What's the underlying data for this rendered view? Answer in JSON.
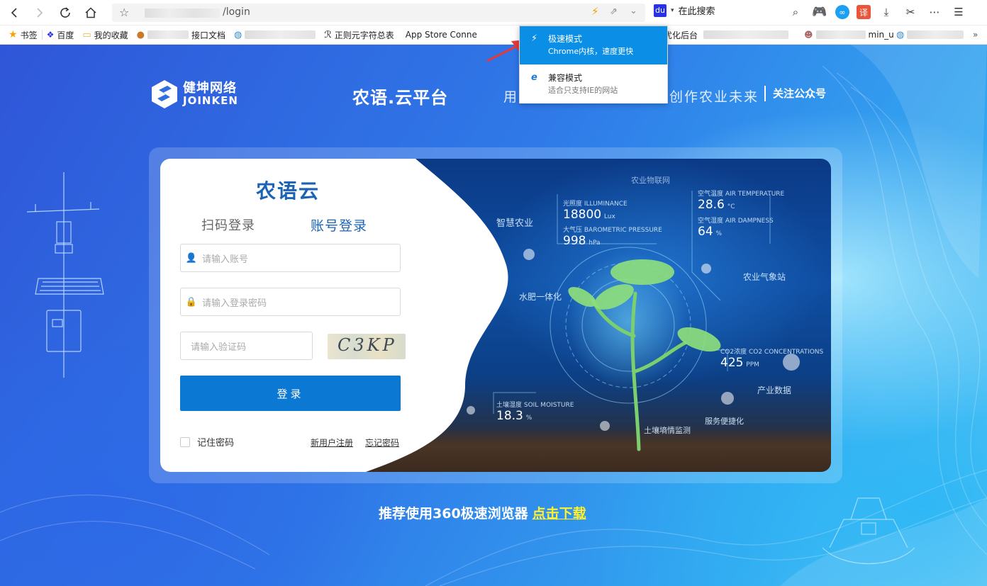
{
  "browser": {
    "address": {
      "url_visible": "/login"
    },
    "search": {
      "label": "在此搜索"
    },
    "bookmarks": [
      {
        "label": "书签"
      },
      {
        "label": "百度"
      },
      {
        "label": "我的收藏"
      },
      {
        "label": "接口文档"
      },
      {
        "label": "正则元字符总表"
      },
      {
        "label": "App Store Conne"
      },
      {
        "label": "优化后台"
      },
      {
        "label": "min_u"
      }
    ],
    "speed_menu": {
      "fast": {
        "title": "极速模式",
        "desc": "Chrome内核，速度更快"
      },
      "compat": {
        "title": "兼容模式",
        "desc": "适合只支持IE的网站"
      }
    }
  },
  "header": {
    "logo_cn": "健坤网络",
    "logo_en": "JOINKEN",
    "platform": "农语.云平台",
    "slogan_a": "用",
    "slogan_b": "创作农业未来",
    "follow": "关注公众号"
  },
  "login": {
    "brand": "农语云",
    "tab_qr": "扫码登录",
    "tab_account": "账号登录",
    "username_placeholder": "请输入账号",
    "password_placeholder": "请输入登录密码",
    "captcha_placeholder": "请输入验证码",
    "captcha_text": "C3KP",
    "submit": "登录",
    "remember": "记住密码",
    "register": "新用户注册",
    "forgot": "忘记密码"
  },
  "photo_labels": {
    "smart_agri": "智慧农业",
    "iot_net": "农业物联网",
    "light_title": "光照度 ILLUMINANCE",
    "light_value": "18800",
    "light_unit": "Lux",
    "pressure_title": "大气压 BAROMETRIC PRESSURE",
    "pressure_value": "998",
    "pressure_unit": "hPa",
    "air_temp_title": "空气温度 AIR TEMPERATURE",
    "air_temp_value": "28.6",
    "air_temp_unit": "°C",
    "air_hum_title": "空气湿度 AIR DAMPNESS",
    "air_hum_value": "64",
    "air_hum_unit": "%",
    "weather": "农业气象站",
    "fert": "水肥一体化",
    "co2_title": "CO2浓度 CO2 CONCENTRATIONS",
    "co2_value": "425",
    "co2_unit": "PPM",
    "industry": "产业数据",
    "soil_title": "土壤湿度 SOIL MOISTURE",
    "soil_value": "18.3",
    "soil_unit": "%",
    "service": "服务便捷化",
    "soil_monitor": "土壤墒情监测"
  },
  "footer": {
    "recommend": "推荐使用360极速浏览器",
    "download": "点击下载"
  },
  "colors": {
    "primary": "#0b78d3",
    "brand_text": "#1b63b5",
    "menu_active": "#0a8ee6",
    "download_link": "#fff22d"
  }
}
